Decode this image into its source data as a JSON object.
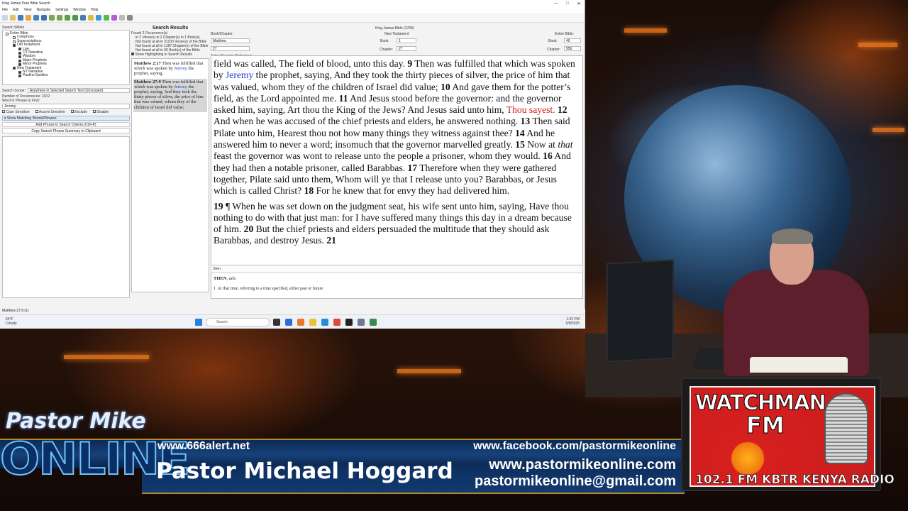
{
  "window": {
    "title": "King James Pure Bible Search",
    "controls": [
      "—",
      "□",
      "✕"
    ]
  },
  "menu": [
    "File",
    "Edit",
    "View",
    "Navigate",
    "Settings",
    "Window",
    "Help"
  ],
  "search_within": {
    "label": "Search Within",
    "tree": [
      {
        "label": "Entire Bible",
        "checked": false
      },
      {
        "label": "Colophons",
        "checked": false
      },
      {
        "label": "Superscriptions",
        "checked": false
      },
      {
        "label": "Old Testament",
        "checked": true
      },
      {
        "label": "Law",
        "checked": true
      },
      {
        "label": "OT Narrative",
        "checked": true
      },
      {
        "label": "Wisdom",
        "checked": true
      },
      {
        "label": "Major Prophets",
        "checked": true
      },
      {
        "label": "Minor Prophets",
        "checked": true
      },
      {
        "label": "New Testament",
        "checked": true
      },
      {
        "label": "NT Narrative",
        "checked": true
      },
      {
        "label": "Pauline Epistles",
        "checked": true
      }
    ],
    "scope_label": "Search Scope:",
    "scope_value": "Anywhere in Selected Search Text (Unscoped)",
    "occurrences": "Number of Occurrences: 2/2/2",
    "word_label": "Word or Phrase to Find:",
    "word_value": "Jeremy",
    "options": [
      "Case Sensitive",
      "Accent Sensitive",
      "Exclude",
      "Disable"
    ],
    "show_matching": "Show Matching Words/Phrases",
    "add_phrase": "Add Phrase to Search Criteria (Ctrl+P)",
    "copy_summary": "Copy Search Phrase Summary to Clipboard"
  },
  "results": {
    "title": "Search Results",
    "summary": [
      "Found 2 Occurrence(s)",
      "in 2 Verse(s) in 2 Chapter(s) in 1 Book(s)",
      "Not found at all in 31100 Verse(s) of the Bible",
      "Not found at all in 1187 Chapter(s) of the Bible",
      "Not found at all in 65 Book(s) of the Bible"
    ],
    "highlight_label": "Show Highlighting in Search Results",
    "items": [
      {
        "ref": "Matthew 2:17",
        "pre": " Then was fulfilled that which was spoken by ",
        "hit": "Jeremy",
        "post": " the prophet, saying,"
      },
      {
        "ref": "Matthew 27:9",
        "pre": " Then was fulfilled that which was spoken by ",
        "hit": "Jeremy",
        "post": " the prophet, saying, And they took the thirty pieces of silver, the price of him that was valued, whom they of the children of Israel did value;"
      }
    ]
  },
  "reference": {
    "book_chapter_label": "Book/Chapter:",
    "book": "Matthew",
    "chapter": "27",
    "passage_label": "Enter Passage Reference:",
    "version": "King James Bible (1769)",
    "testament": "New Testament",
    "nt_book_label": "Book:",
    "nt_book": "1",
    "nt_chapter_label": "Chapter:",
    "nt_chapter": "27",
    "entire_label": "Entire Bible:",
    "entire_book_label": "Book:",
    "entire_book": "40",
    "entire_chapter_label": "Chapter:",
    "entire_chapter": "956"
  },
  "reader": {
    "p1": {
      "t1": "field was called, The field of blood, unto this day. ",
      "v9": "9",
      "t2": " Then was fulfilled that which was spoken by ",
      "jeremy": "Jeremy",
      "t3": " the prophet, saying, And they took the thirty pieces of silver, the price of him that was valued, whom they of the children of Israel did value; ",
      "v10": "10",
      "t4": " And gave them for the potter’s field, as the Lord appointed me. ",
      "v11": "11",
      "t5": " And Jesus stood before the governor: and the governor asked him, saying, Art thou the King of the Jews? And Jesus said unto him, ",
      "red": "Thou sayest.",
      "t6": " ",
      "v12": "12",
      "t7": " And when he was accused of the chief priests and elders, he answered nothing. ",
      "v13": "13",
      "t8": " Then said Pilate unto him, Hearest thou not how many things they witness against thee? ",
      "v14": "14",
      "t9": " And he answered him to never a word; insomuch that the governor marvelled greatly. ",
      "v15": "15",
      "t10": " Now at ",
      "that": "that",
      "t11": " feast the governor was wont to release unto the people a prisoner, whom they would. ",
      "v16": "16",
      "t12": " And they had then a notable prisoner, called Barabbas. ",
      "v17": "17",
      "t13": " Therefore when they were gathered together, Pilate said unto them, Whom will ye that I release unto you? Barabbas, or Jesus which is called Christ? ",
      "v18": "18",
      "t14": " For he knew that for envy they had delivered him."
    },
    "p2": {
      "v19": "19",
      "t1": " ¶ When he was set down on the judgment seat, his wife sent unto him, saying, Have thou nothing to do with that just man: for I have suffered many things this day in a dream because of him. ",
      "v20": "20",
      "t2": " But the chief priests and elders persuaded the multitude that they should ask Barabbas, and destroy Jesus. ",
      "v21": "21"
    }
  },
  "dictionary": {
    "word": "then",
    "headword": "THEN",
    "pos": ", adv.",
    "definition": "1. At that time, referring to a time specified, either past or future."
  },
  "status": "Matthew 27:9 (1)",
  "taskbar": {
    "temp": "64°F",
    "weather": "Cloudy",
    "search": "Search",
    "time": "1:32 PM",
    "date": "5/8/2025"
  },
  "lower_third": {
    "brand_top": "Pastor Mike",
    "brand_big": "ONLINE",
    "site1": "www.666alert.net",
    "facebook": "www.facebook.com/pastormikeonline",
    "name": "Pastor Michael Hoggard",
    "site2": "www.pastormikeonline.com",
    "email": "pastormikeonline@gmail.com"
  },
  "radio": {
    "watchman": "WATCHMAN",
    "fm": "FM",
    "freq": "102.1 FM  KBTR KENYA RADIO"
  }
}
